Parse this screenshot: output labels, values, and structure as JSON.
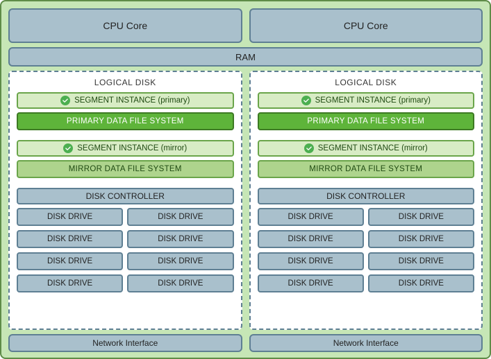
{
  "cpu": {
    "left": "CPU Core",
    "right": "CPU Core"
  },
  "ram": "RAM",
  "logical": {
    "title": "LOGICAL DISK",
    "segment_primary": "SEGMENT INSTANCE (primary)",
    "primary_fs": "PRIMARY DATA FILE SYSTEM",
    "segment_mirror": "SEGMENT INSTANCE (mirror)",
    "mirror_fs": "MIRROR DATA FILE SYSTEM",
    "disk_controller": "DISK CONTROLLER",
    "drive": "DISK DRIVE"
  },
  "network": {
    "left": "Network Interface",
    "right": "Network Interface"
  }
}
